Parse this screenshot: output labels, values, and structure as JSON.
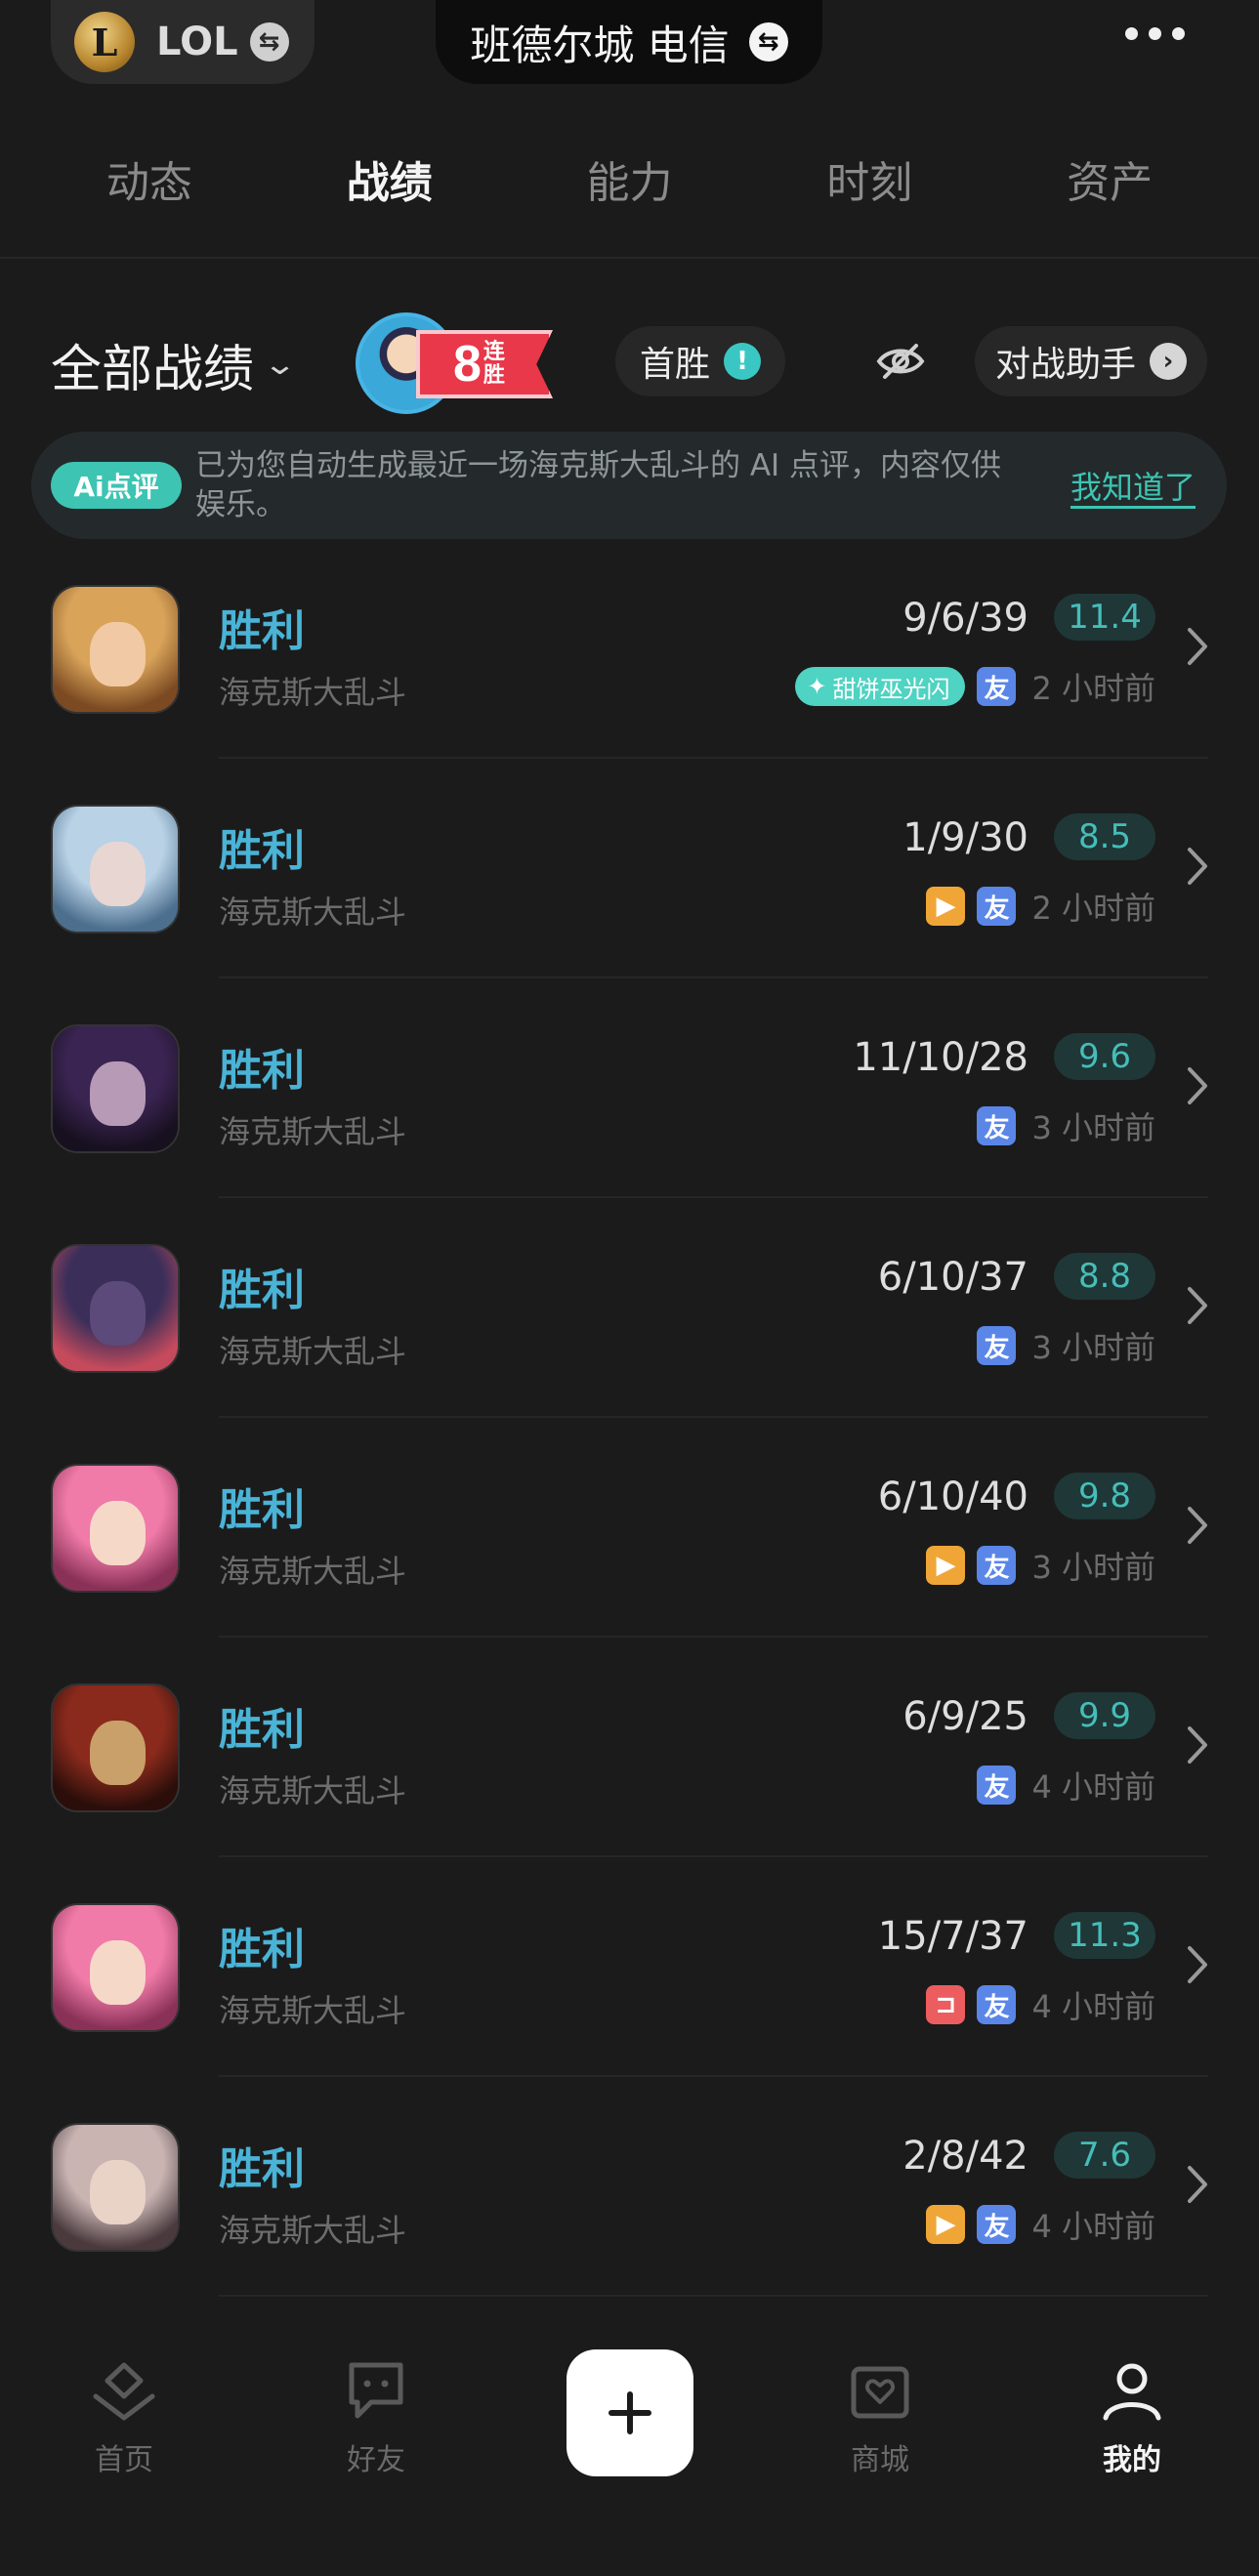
{
  "header": {
    "game": "LOL",
    "logo_letter": "L",
    "server": "班德尔城 电信",
    "swap_glyph": "⇆"
  },
  "tabs": [
    {
      "label": "动态",
      "active": false
    },
    {
      "label": "战绩",
      "active": true
    },
    {
      "label": "能力",
      "active": false
    },
    {
      "label": "时刻",
      "active": false
    },
    {
      "label": "资产",
      "active": false
    }
  ],
  "filter": {
    "title": "全部战绩",
    "streak_number": "8",
    "streak_text": "连胜",
    "first_win": "首胜",
    "assistant": "对战助手"
  },
  "ai_banner": {
    "badge": "Ai点评",
    "text": "已为您自动生成最近一场海克斯大乱斗的 AI 点评，内容仅供娱乐。",
    "link": "我知道了"
  },
  "matches": [
    {
      "result": "胜利",
      "mode": "海克斯大乱斗",
      "kda": "9/6/39",
      "score": "11.4",
      "time": "2 小时前",
      "tags": [
        "ai",
        "friend"
      ],
      "ai_tag": "甜饼巫光闪"
    },
    {
      "result": "胜利",
      "mode": "海克斯大乱斗",
      "kda": "1/9/30",
      "score": "8.5",
      "time": "2 小时前",
      "tags": [
        "video",
        "friend"
      ]
    },
    {
      "result": "胜利",
      "mode": "海克斯大乱斗",
      "kda": "11/10/28",
      "score": "9.6",
      "time": "3 小时前",
      "tags": [
        "friend"
      ]
    },
    {
      "result": "胜利",
      "mode": "海克斯大乱斗",
      "kda": "6/10/37",
      "score": "8.8",
      "time": "3 小时前",
      "tags": [
        "friend"
      ]
    },
    {
      "result": "胜利",
      "mode": "海克斯大乱斗",
      "kda": "6/10/40",
      "score": "9.8",
      "time": "3 小时前",
      "tags": [
        "video",
        "friend"
      ]
    },
    {
      "result": "胜利",
      "mode": "海克斯大乱斗",
      "kda": "6/9/25",
      "score": "9.9",
      "time": "4 小时前",
      "tags": [
        "friend"
      ]
    },
    {
      "result": "胜利",
      "mode": "海克斯大乱斗",
      "kda": "15/7/37",
      "score": "11.3",
      "time": "4 小时前",
      "tags": [
        "red",
        "friend"
      ]
    },
    {
      "result": "胜利",
      "mode": "海克斯大乱斗",
      "kda": "2/8/42",
      "score": "7.6",
      "time": "4 小时前",
      "tags": [
        "video",
        "friend"
      ]
    }
  ],
  "tag_glyphs": {
    "friend": "友",
    "video": "▶",
    "red": "⊐"
  },
  "avatars": [
    {
      "skin": "#d9a45a",
      "bg": "#7c4a22",
      "face": "#f1c9a4"
    },
    {
      "skin": "#b9d2e6",
      "bg": "#4c6f8e",
      "face": "#e8d6d2"
    },
    {
      "skin": "#3a2452",
      "bg": "#17101f",
      "face": "#b79ab6"
    },
    {
      "skin": "#3b2f5a",
      "bg": "#c44a5c",
      "face": "#5c4a7a"
    },
    {
      "skin": "#f07aa8",
      "bg": "#8a3158",
      "face": "#f6d8c8"
    },
    {
      "skin": "#8a2a1c",
      "bg": "#2b0e0a",
      "face": "#c9a06a"
    },
    {
      "skin": "#f07aa8",
      "bg": "#8a3158",
      "face": "#f6d8c8"
    },
    {
      "skin": "#c9b4b2",
      "bg": "#4a3a3e",
      "face": "#e9d2c6"
    }
  ],
  "colors": {
    "accent_teal": "#3ec4b3",
    "win_blue": "#4ab3d6",
    "friend_blue": "#5a86e8",
    "video_orange": "#f0a637",
    "streak_red": "#e8384a"
  },
  "bottom_nav": [
    {
      "label": "首页",
      "icon": "home-diamond-icon",
      "active": false
    },
    {
      "label": "好友",
      "icon": "chat-icon",
      "active": false
    },
    {
      "label": "",
      "icon": "plus-icon",
      "active": false
    },
    {
      "label": "商城",
      "icon": "shop-heart-icon",
      "active": false
    },
    {
      "label": "我的",
      "icon": "profile-icon",
      "active": true
    }
  ]
}
